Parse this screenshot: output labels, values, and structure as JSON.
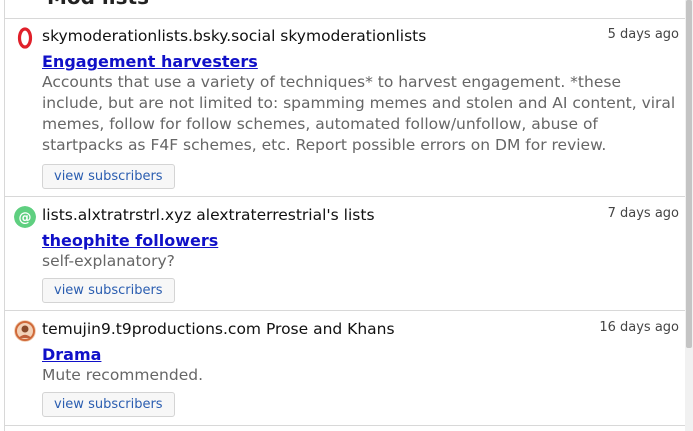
{
  "header": {
    "title_cut": "Mod lists"
  },
  "lists": [
    {
      "avatar_icon": "opera-icon",
      "avatar_color": "#e0202a",
      "owner": "skymoderationlists.bsky.social skymoderationlists",
      "time": "5 days ago",
      "name": "Engagement harvesters",
      "description": "Accounts that use a variety of techniques* to harvest engagement. *these include, but are not limited to: spamming memes and stolen and AI content, viral memes, follow for follow schemes, automated follow/unfollow, abuse of startpacks as F4F schemes, etc. Report possible errors on DM for review.",
      "button": "view subscribers"
    },
    {
      "avatar_icon": "at-sign-icon",
      "avatar_color": "#5fcf80",
      "owner": "lists.alxtratrstrl.xyz alextraterrestrial's lists",
      "time": "7 days ago",
      "name": "theophite followers",
      "description": "self-explanatory?",
      "button": "view subscribers"
    },
    {
      "avatar_icon": "user-avatar-icon",
      "avatar_color": "#d06a3a",
      "owner": "temujin9.t9productions.com Prose and Khans",
      "time": "16 days ago",
      "name": "Drama",
      "description": "Mute recommended.",
      "button": "view subscribers"
    }
  ]
}
